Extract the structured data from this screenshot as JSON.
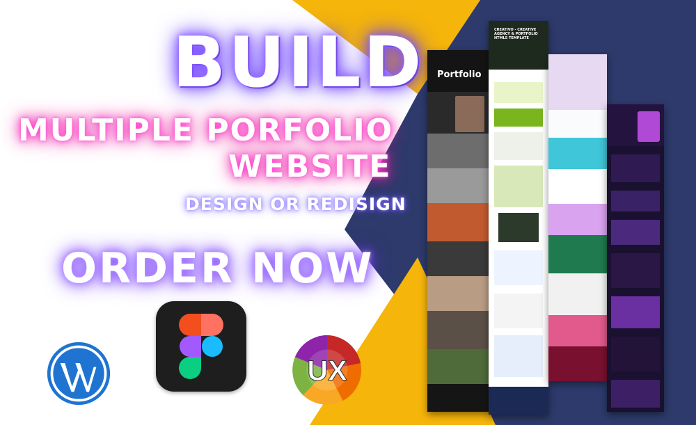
{
  "headline": {
    "line1": "BUILD",
    "line2": "MULTIPLE PORFOLIO",
    "line3": "WEBSITE",
    "line4": "DESIGN OR REDISIGN",
    "cta": "ORDER NOW"
  },
  "logos": {
    "wordpress": "wordpress-icon",
    "figma": "figma-icon",
    "ux": {
      "icon": "ux-icon",
      "text": "UX"
    }
  },
  "mockups": {
    "portfolio_title": "Portfolio",
    "creative_title": "CREATIVO - CREATIVE AGENCY & PORTFOLIO HTML5 TEMPLATE"
  },
  "colors": {
    "navy": "#2d3a6b",
    "yellow": "#f5b50a",
    "pink_glow": "#ff2ec4",
    "purple_glow": "#7b4dff"
  }
}
